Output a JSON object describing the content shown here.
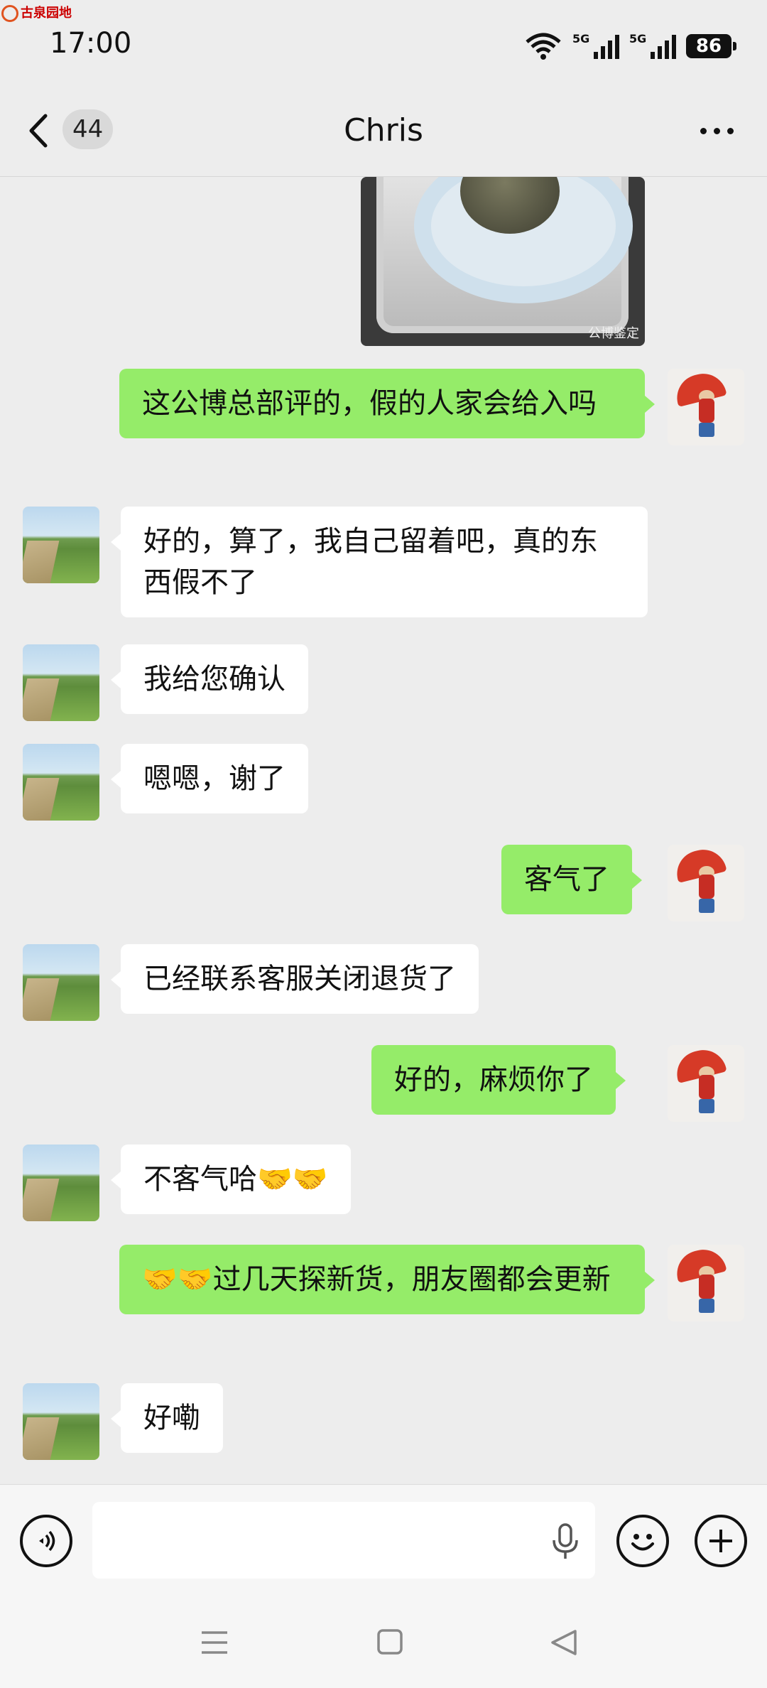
{
  "status_bar": {
    "watermark": "古泉园地",
    "time": "17:00",
    "signal_1": "5G",
    "signal_2": "5G",
    "battery": "86"
  },
  "header": {
    "unread_count": "44",
    "title": "Chris"
  },
  "image_message": {
    "caption": "公博鉴定"
  },
  "messages": [
    {
      "side": "out",
      "text": "这公博总部评的，假的人家会给入吗"
    },
    {
      "side": "in",
      "text": "好的，算了，我自己留着吧，真的东西假不了"
    },
    {
      "side": "in",
      "text": "我给您确认"
    },
    {
      "side": "in",
      "text": "嗯嗯，谢了"
    },
    {
      "side": "out",
      "text": "客气了"
    },
    {
      "side": "in",
      "text": "已经联系客服关闭退货了"
    },
    {
      "side": "out",
      "text": "好的，麻烦你了"
    },
    {
      "side": "in",
      "text": "不客气哈🤝🤝"
    },
    {
      "side": "out",
      "text": "🤝🤝过几天探新货，朋友圈都会更新"
    },
    {
      "side": "in",
      "text": "好嘞"
    }
  ],
  "icons": {
    "back": "chevron-left-icon",
    "more": "more-dots-icon",
    "voice": "voice-icon",
    "mic": "microphone-icon",
    "emoji": "emoji-icon",
    "plus": "plus-icon",
    "nav_menu": "menu-icon",
    "nav_home": "home-icon",
    "nav_back": "back-triangle-icon"
  },
  "colors": {
    "outgoing_bubble": "#95ec69",
    "incoming_bubble": "#ffffff",
    "background": "#ededed"
  }
}
